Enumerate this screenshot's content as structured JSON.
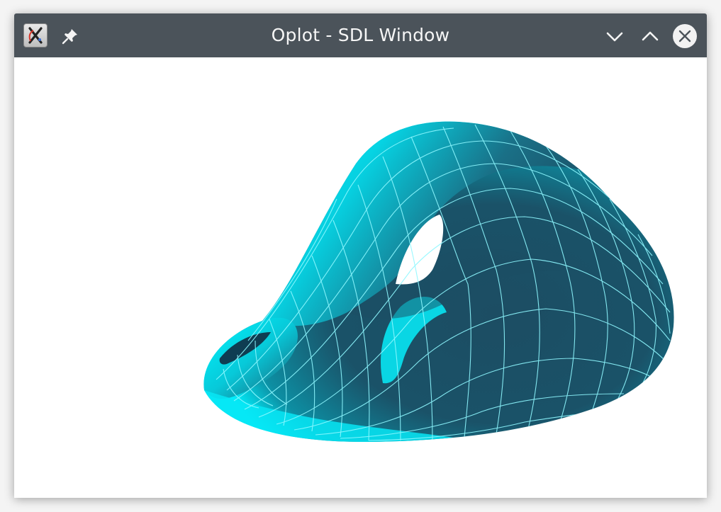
{
  "window": {
    "title": "Oplot - SDL Window",
    "buttons": {
      "app_menu_icon": "app-x-icon",
      "pin_icon": "pin-icon",
      "minimize_icon": "chevron-down-icon",
      "maximize_icon": "chevron-up-icon",
      "close_icon": "close-icon"
    }
  },
  "viewport": {
    "content": "3d-surface-plot",
    "surface_colors": {
      "bright": "#00f6ff",
      "mid": "#0a9fb0",
      "dark": "#1c4d63",
      "wireframe": "#7ff6ff"
    }
  }
}
